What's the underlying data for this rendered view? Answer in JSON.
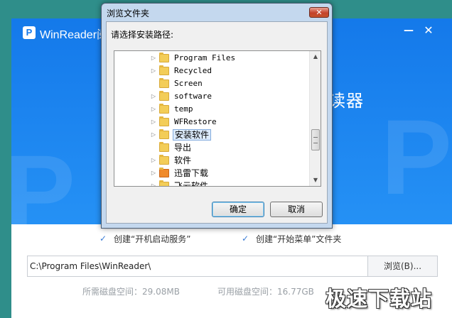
{
  "installer": {
    "title": "WinReader阅",
    "hero_suffix": "读器",
    "minimize_icon": "minimize-icon",
    "close_icon": "close-icon",
    "options": {
      "startup_service": "创建“开机启动服务”",
      "start_menu": "创建“开始菜单”文件夹",
      "startup_checked": true,
      "start_menu_checked": true
    },
    "install_path": "C:\\Program Files\\WinReader\\",
    "browse_label": "浏览(B)...",
    "disk_required": "所需磁盘空间：29.08MB",
    "disk_available": "可用磁盘空间：16.77GB",
    "accent_color": "#1479ea"
  },
  "dialog": {
    "title": "浏览文件夹",
    "close_label": "✕",
    "prompt": "请选择安装路径:",
    "folders": [
      {
        "name": "Program Files",
        "has_children": true
      },
      {
        "name": "Recycled",
        "has_children": true
      },
      {
        "name": "Screen",
        "has_children": false
      },
      {
        "name": "software",
        "has_children": true
      },
      {
        "name": "temp",
        "has_children": true
      },
      {
        "name": "WFRestore",
        "has_children": true
      },
      {
        "name": "安装软件",
        "has_children": true,
        "selected": true
      },
      {
        "name": "导出",
        "has_children": false
      },
      {
        "name": "软件",
        "has_children": true
      },
      {
        "name": "迅雷下载",
        "has_children": true,
        "special": true
      },
      {
        "name": "飞云软件",
        "has_children": true
      }
    ],
    "ok_label": "确定",
    "cancel_label": "取消"
  },
  "watermark": "极速下载站"
}
